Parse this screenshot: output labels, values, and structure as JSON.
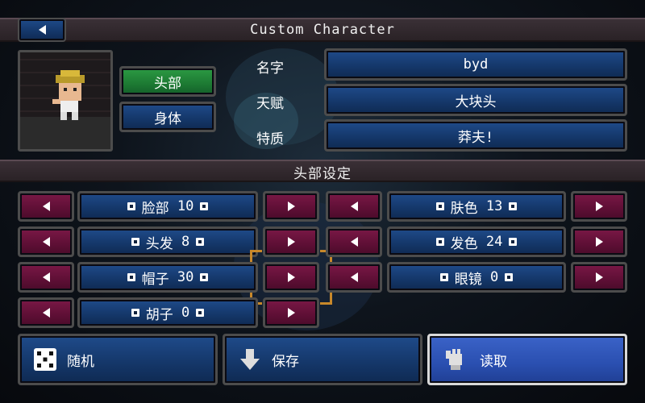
{
  "header": {
    "title": "Custom Character",
    "back_icon": "back-arrow-icon"
  },
  "tabs": [
    {
      "label": "头部",
      "active": true
    },
    {
      "label": "身体",
      "active": false
    }
  ],
  "fields": [
    {
      "label": "名字",
      "value": "byd"
    },
    {
      "label": "天赋",
      "value": "大块头"
    },
    {
      "label": "特质",
      "value": "莽夫!"
    }
  ],
  "section": {
    "title": "头部设定"
  },
  "settings_left": [
    {
      "name": "脸部",
      "value": "10"
    },
    {
      "name": "头发",
      "value": "8"
    },
    {
      "name": "帽子",
      "value": "30"
    },
    {
      "name": "胡子",
      "value": "0"
    }
  ],
  "settings_right": [
    {
      "name": "肤色",
      "value": "13"
    },
    {
      "name": "发色",
      "value": "24"
    },
    {
      "name": "眼镜",
      "value": "0"
    }
  ],
  "actions": [
    {
      "label": "随机",
      "icon": "dice-icon"
    },
    {
      "label": "保存",
      "icon": "down-arrow-icon"
    },
    {
      "label": "读取",
      "icon": "hand-icon"
    }
  ],
  "colors": {
    "blue_button": "#143668",
    "red_button": "#5e0f35",
    "green_tab": "#1d7a33",
    "selection_corner": "#c8882a"
  }
}
